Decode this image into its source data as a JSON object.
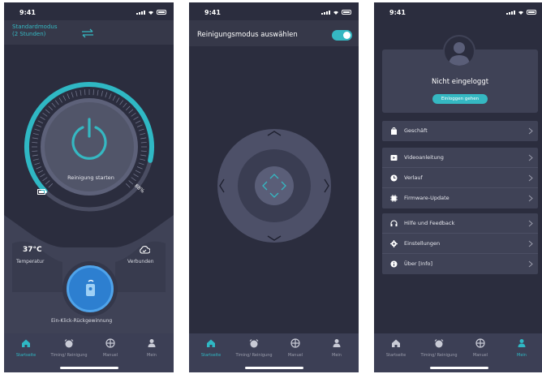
{
  "status_time": "9:41",
  "tabs": [
    "Startseite",
    "Timing/ Reinigung",
    "Manuel",
    "Mein"
  ],
  "screen1": {
    "mode": [
      "Standardmodus",
      "(2 Stunden)"
    ],
    "start_label": "Reinigung starten",
    "battery_percent": "88%",
    "battery_level": 0.88,
    "temperature": "37°C",
    "temperature_label": "Temperatur",
    "connection_label": "Verbunden",
    "recall_label": "Ein-Klick-Rückgewinnung",
    "active_tab": 0
  },
  "screen2": {
    "title": "Reinigungsmodus auswählen",
    "toggle_on": true,
    "active_tab": 0
  },
  "screen3": {
    "login_status": "Nicht eingeloggt",
    "login_button": "Einloggen gehen",
    "groups": [
      [
        {
          "icon": "shop-icon",
          "label": "Geschäft"
        }
      ],
      [
        {
          "icon": "video-icon",
          "label": "Videoanleitung"
        },
        {
          "icon": "history-icon",
          "label": "Verlauf"
        },
        {
          "icon": "firmware-icon",
          "label": "Firmware-Update"
        }
      ],
      [
        {
          "icon": "headset-icon",
          "label": "Hilfe und Feedback"
        },
        {
          "icon": "settings-icon",
          "label": "Einstellungen"
        },
        {
          "icon": "info-icon",
          "label": "Über [Info]"
        }
      ]
    ],
    "active_tab": 3
  },
  "colors": {
    "accent": "#35b8c2",
    "background": "#2b2d3e",
    "card": "#3f4256",
    "button": "#2d7fd0"
  }
}
